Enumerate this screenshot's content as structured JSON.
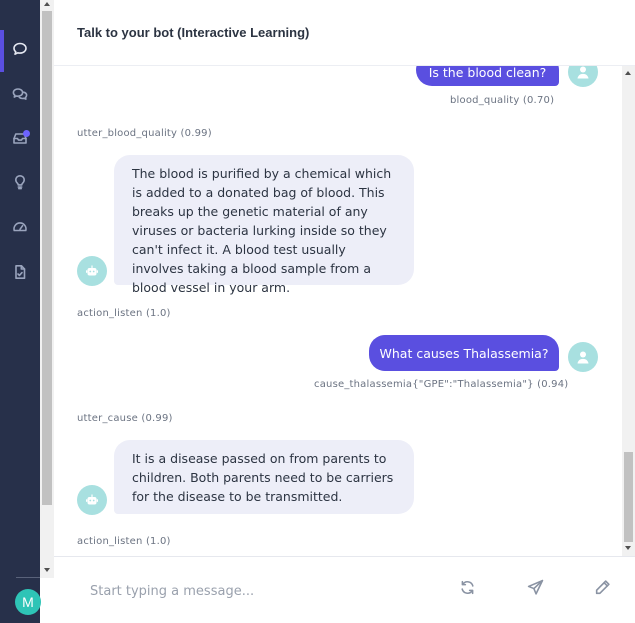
{
  "header": {
    "title": "Talk to your bot (Interactive Learning)"
  },
  "sidebar": {
    "items": [
      {
        "icon": "chat-bubble-icon",
        "active": true
      },
      {
        "icon": "conversations-icon",
        "active": false
      },
      {
        "icon": "inbox-icon",
        "active": false,
        "notification": true
      },
      {
        "icon": "lightbulb-icon",
        "active": false
      },
      {
        "icon": "dashboard-icon",
        "active": false
      },
      {
        "icon": "document-icon",
        "active": false
      }
    ],
    "user_initial": "M",
    "user_avatar_color": "#2ec4b6"
  },
  "messages": [
    {
      "sender": "user",
      "text": "Is the blood clean?",
      "intent": "blood_quality (0.70)"
    },
    {
      "sender": "bot",
      "action": "utter_blood_quality (0.99)",
      "text": "The blood is purified by a chemical which is added to a donated bag of blood. This breaks up the genetic material of any viruses or bacteria lurking inside so they can't infect it. A blood test usually involves taking a blood sample from a blood vessel in your arm."
    },
    {
      "sender": "system",
      "action": "action_listen (1.0)"
    },
    {
      "sender": "user",
      "text": "What causes Thalassemia?",
      "intent": "cause_thalassemia{\"GPE\":\"Thalassemia\"} (0.94)"
    },
    {
      "sender": "bot",
      "action": "utter_cause (0.99)",
      "text": "It is a disease passed on from parents to children. Both parents need to be carriers for the disease to be transmitted."
    },
    {
      "sender": "system",
      "action": "action_listen (1.0)"
    }
  ],
  "composer": {
    "placeholder": "Start typing a message...",
    "buttons": [
      "restart-icon",
      "send-icon",
      "pen-icon"
    ]
  },
  "colors": {
    "accent": "#5a4fe0",
    "rail": "#27304a",
    "bot_bubble": "#edeef8",
    "avatar": "#a8e0e0"
  }
}
